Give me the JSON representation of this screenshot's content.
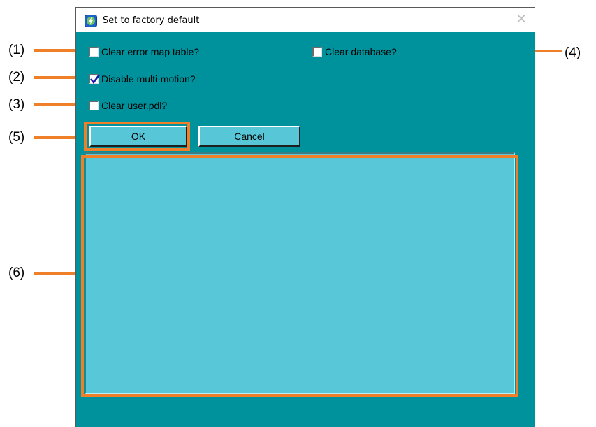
{
  "window": {
    "title": "Set to factory default",
    "close_glyph": "✕"
  },
  "options": {
    "clear_error_map": {
      "label": "Clear error map table?",
      "checked": false
    },
    "clear_database": {
      "label": "Clear database?",
      "checked": false
    },
    "disable_multi_motion": {
      "label": "Disable multi-motion?",
      "checked": true
    },
    "clear_user_pdl": {
      "label": "Clear user.pdl?",
      "checked": false
    }
  },
  "buttons": {
    "ok": "OK",
    "cancel": "Cancel"
  },
  "callouts": {
    "c1": "(1)",
    "c2": "(2)",
    "c3": "(3)",
    "c4": "(4)",
    "c5": "(5)",
    "c6": "(6)"
  },
  "colors": {
    "dialog_bg": "#00929c",
    "control_bg": "#57c7d8",
    "highlight": "#f07f2a"
  },
  "icons": {
    "app": "app-logo-icon",
    "close": "close-icon",
    "check": "checkmark-icon"
  }
}
